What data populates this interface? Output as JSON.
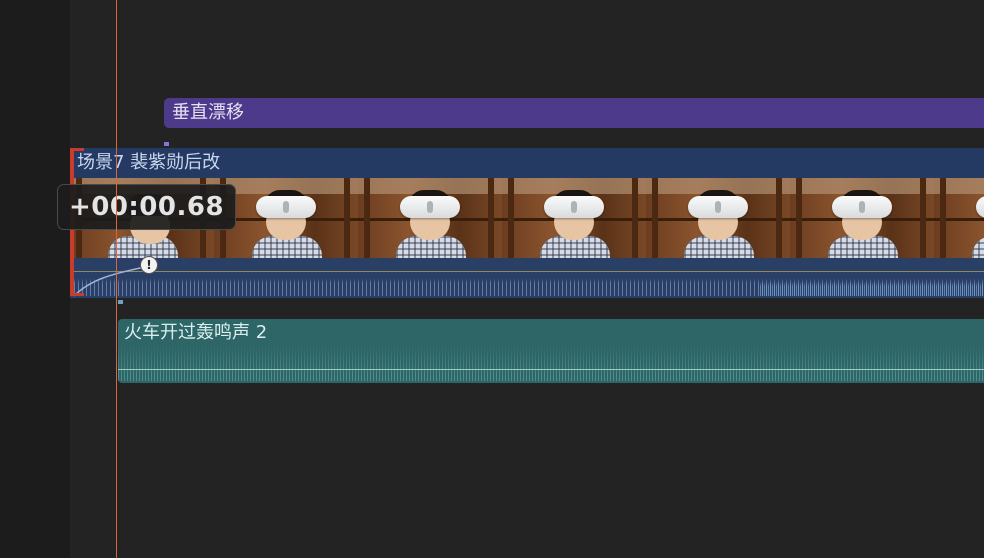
{
  "timeline": {
    "title_clip": {
      "label": "垂直漂移"
    },
    "video_clip": {
      "label": "场景7 裴紫勋后改",
      "frame_count": 7
    },
    "audio_clip": {
      "label": "火车开过轰鸣声 2"
    },
    "trim_tooltip": {
      "value": "+00:00.68"
    },
    "fade_handle": {
      "glyph": "!"
    }
  },
  "colors": {
    "title_clip": "#4e3a8a",
    "video_clip": "#243a63",
    "audio_clip": "#2e6566",
    "playhead": "#d8673f",
    "trim_handle": "#c93b2a"
  }
}
